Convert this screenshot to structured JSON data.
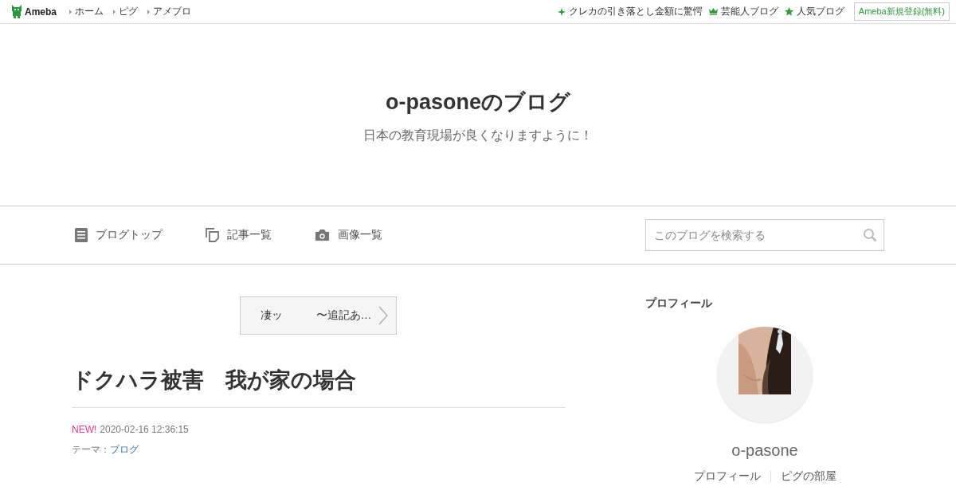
{
  "top_bar": {
    "logo": "Ameba",
    "links": [
      "ホーム",
      "ピグ",
      "アメブロ"
    ],
    "right_links": [
      {
        "kind": "sparkle",
        "label": "クレカの引き落とし金額に驚愕"
      },
      {
        "kind": "crown",
        "label": "芸能人ブログ"
      },
      {
        "kind": "star",
        "label": "人気ブログ"
      }
    ],
    "register_button": "Ameba新規登録(無料)"
  },
  "blog": {
    "title": "o-pasoneのブログ",
    "subtitle": "日本の教育現場が良くなりますように！"
  },
  "nav": {
    "items": [
      {
        "kind": "document",
        "label": "ブログトップ"
      },
      {
        "kind": "pages",
        "label": "記事一覧"
      },
      {
        "kind": "camera",
        "label": "画像一覧"
      }
    ],
    "search": {
      "placeholder": "このブログを検索する"
    }
  },
  "article": {
    "pager_link": "凄ッ　　　〜追記あ…",
    "title": "ドクハラ被害　我が家の場合",
    "new_badge": "NEW!",
    "date": "2020-02-16 12:36:15",
    "theme_label": "テーマ：",
    "theme": "ブログ"
  },
  "sidebar": {
    "heading": "プロフィール",
    "profile": {
      "image": {
        "kind": "picture"
      },
      "name": "o-pasone",
      "links": [
        "プロフィール",
        "ピグの部屋"
      ]
    }
  }
}
